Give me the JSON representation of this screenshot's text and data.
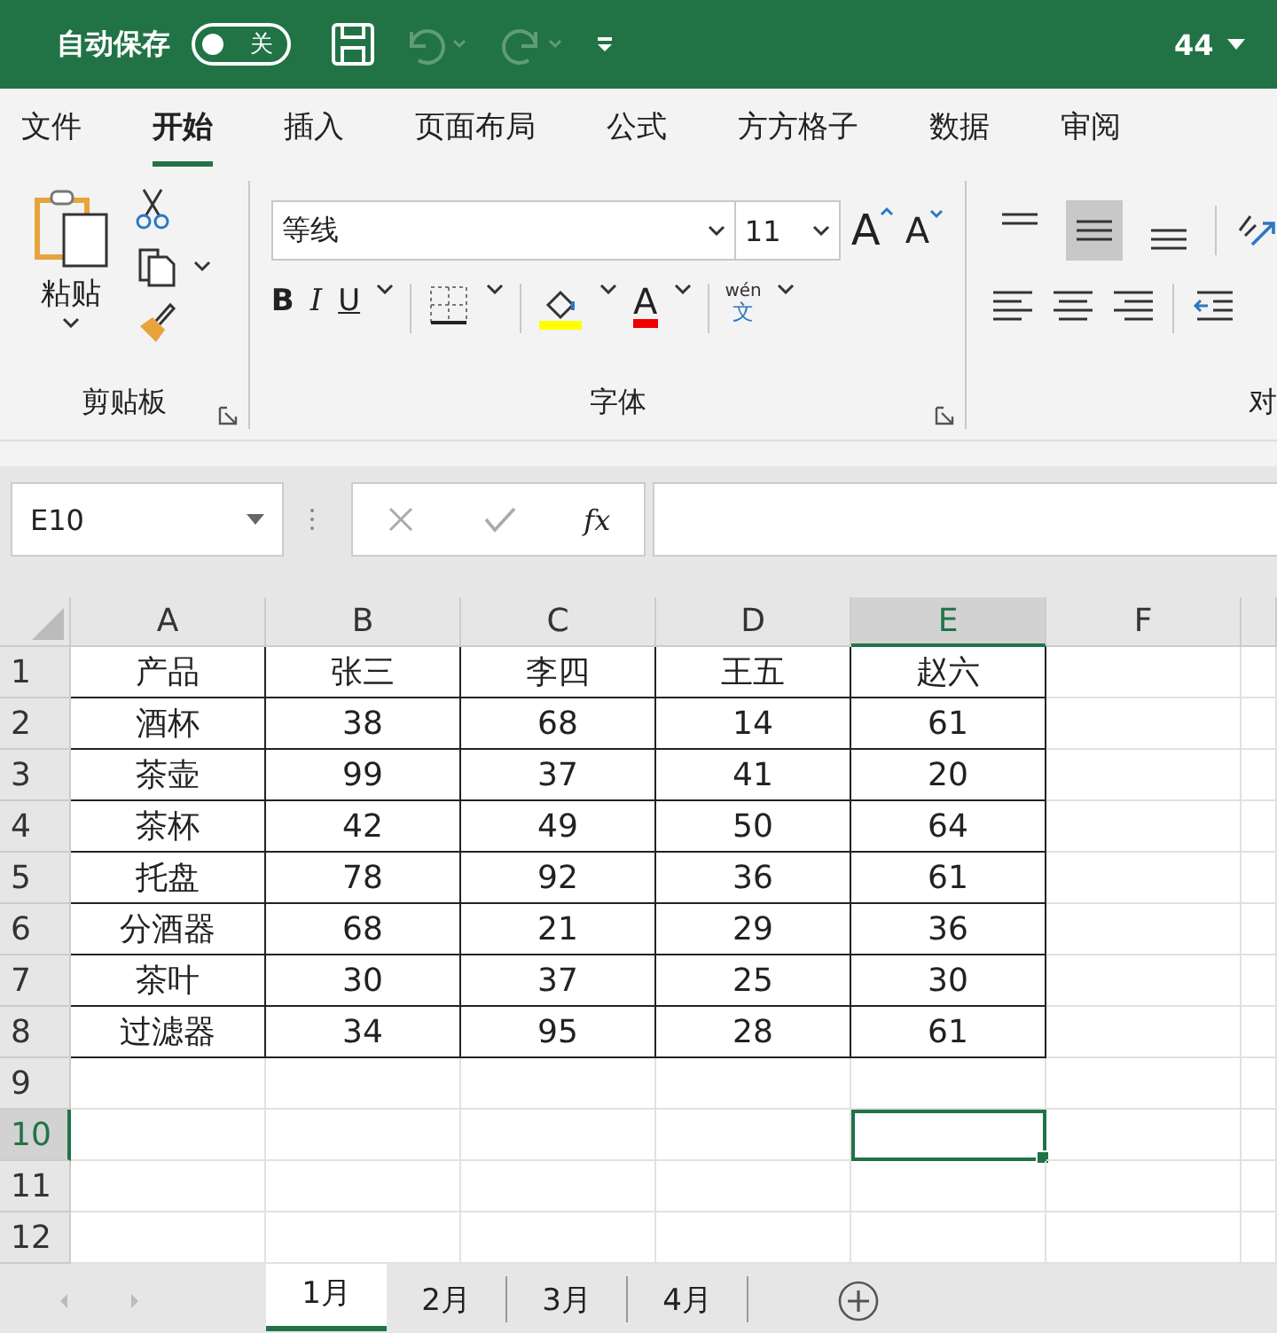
{
  "title_bar": {
    "autosave_label": "自动保存",
    "autosave_toggle": {
      "label": "关",
      "on": false
    },
    "document_title": "44"
  },
  "ribbon_tabs": [
    {
      "label": "文件",
      "selected": false
    },
    {
      "label": "开始",
      "selected": true
    },
    {
      "label": "插入",
      "selected": false
    },
    {
      "label": "页面布局",
      "selected": false
    },
    {
      "label": "公式",
      "selected": false
    },
    {
      "label": "方方格子",
      "selected": false
    },
    {
      "label": "数据",
      "selected": false
    },
    {
      "label": "审阅",
      "selected": false
    }
  ],
  "clipboard_group": {
    "paste_label": "粘贴",
    "group_label": "剪贴板"
  },
  "font_group": {
    "font_name": "等线",
    "font_size": "11",
    "grow_label": "A",
    "shrink_label": "A",
    "bold": "B",
    "italic": "I",
    "underline": "U",
    "font_color_label": "A",
    "phonetic_top": "wén",
    "phonetic_bottom": "文",
    "group_label": "字体"
  },
  "alignment_group": {
    "buttons": [
      {
        "kind": "top",
        "selected": false
      },
      {
        "kind": "middle",
        "selected": true
      },
      {
        "kind": "bottom",
        "selected": false
      }
    ],
    "group_label": "对"
  },
  "formula_bar": {
    "name_box": "E10",
    "fx_label": "fx"
  },
  "sheet": {
    "columns": [
      {
        "label": "A",
        "selected": false
      },
      {
        "label": "B",
        "selected": false
      },
      {
        "label": "C",
        "selected": false
      },
      {
        "label": "D",
        "selected": false
      },
      {
        "label": "E",
        "selected": true
      },
      {
        "label": "F",
        "selected": false
      }
    ],
    "rows": [
      {
        "label": "1",
        "selected": false,
        "cells": [
          "产品",
          "张三",
          "李四",
          "王五",
          "赵六"
        ]
      },
      {
        "label": "2",
        "selected": false,
        "cells": [
          "酒杯",
          "38",
          "68",
          "14",
          "61"
        ]
      },
      {
        "label": "3",
        "selected": false,
        "cells": [
          "茶壶",
          "99",
          "37",
          "41",
          "20"
        ]
      },
      {
        "label": "4",
        "selected": false,
        "cells": [
          "茶杯",
          "42",
          "49",
          "50",
          "64"
        ]
      },
      {
        "label": "5",
        "selected": false,
        "cells": [
          "托盘",
          "78",
          "92",
          "36",
          "61"
        ]
      },
      {
        "label": "6",
        "selected": false,
        "cells": [
          "分酒器",
          "68",
          "21",
          "29",
          "36"
        ]
      },
      {
        "label": "7",
        "selected": false,
        "cells": [
          "茶叶",
          "30",
          "37",
          "25",
          "30"
        ]
      },
      {
        "label": "8",
        "selected": false,
        "cells": [
          "过滤器",
          "34",
          "95",
          "28",
          "61"
        ]
      },
      {
        "label": "9",
        "selected": false
      },
      {
        "label": "10",
        "selected": true
      },
      {
        "label": "11",
        "selected": false
      },
      {
        "label": "12",
        "selected": false
      }
    ]
  },
  "sheet_tabs": [
    {
      "label": "1月",
      "selected": true
    },
    {
      "label": "2月",
      "selected": false
    },
    {
      "label": "3月",
      "selected": false
    },
    {
      "label": "4月",
      "selected": false
    }
  ]
}
